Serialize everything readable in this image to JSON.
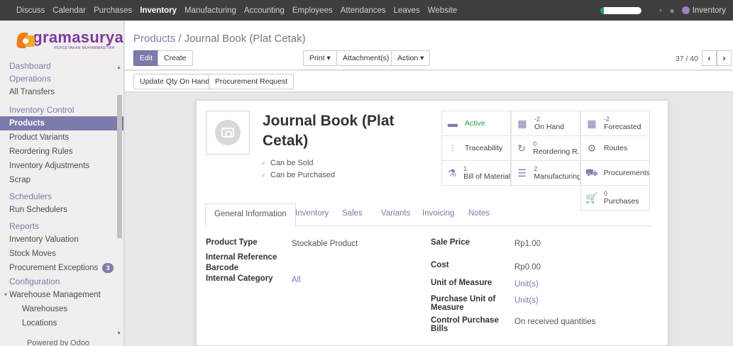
{
  "topbar": {
    "menu": [
      "Discuss",
      "Calendar",
      "Purchases",
      "Inventory",
      "Manufacturing",
      "Accounting",
      "Employees",
      "Attendances",
      "Leaves",
      "Website"
    ],
    "active": "Inventory",
    "user": "Inventory"
  },
  "sidebar": {
    "logo_name": "gramasurya",
    "logo_tag": "PERCETAKAN MUHAMMADIYAH",
    "dashboard": "Dashboard",
    "operations": "Operations",
    "all_transfers": "All Transfers",
    "inventory_control": "Inventory Control",
    "products": "Products",
    "product_variants": "Product Variants",
    "reordering_rules": "Reordering Rules",
    "inventory_adjustments": "Inventory Adjustments",
    "scrap": "Scrap",
    "schedulers": "Schedulers",
    "run_schedulers": "Run Schedulers",
    "reports": "Reports",
    "inventory_valuation": "Inventory Valuation",
    "stock_moves": "Stock Moves",
    "procurement_exceptions": "Procurement Exceptions",
    "procurement_exceptions_count": "3",
    "configuration": "Configuration",
    "warehouse_management": "Warehouse Management",
    "warehouses": "Warehouses",
    "locations": "Locations",
    "powered": "Powered by Odoo"
  },
  "control": {
    "breadcrumb_parent": "Products",
    "breadcrumb_sep": " / ",
    "breadcrumb_current": "Journal Book (Plat Cetak)",
    "edit": "Edit",
    "create": "Create",
    "print": "Print ▾",
    "attachments": "Attachment(s) ▾",
    "action": "Action ▾",
    "pager": "37 / 40"
  },
  "statusbar": {
    "update_qty": "Update Qty On Hand",
    "procurement_request": "Procurement Request"
  },
  "product": {
    "name": "Journal Book (Plat Cetak)",
    "can_be_sold": "Can be Sold",
    "can_be_purchased": "Can be Purchased"
  },
  "smart_buttons": {
    "active": "Active",
    "on_hand_value": "-2",
    "on_hand_label": "On Hand",
    "forecasted_value": "-2",
    "forecasted_label": "Forecasted",
    "traceability": "Traceability",
    "reordering_value": "0",
    "reordering_label": "Reordering R...",
    "routes": "Routes",
    "bom_value": "1",
    "bom_label": "Bill of Materials",
    "manufacturing_value": "2",
    "manufacturing_label": "Manufacturing",
    "procurements": "Procurements",
    "purchases_value": "0",
    "purchases_label": "Purchases"
  },
  "tabs": [
    "General Information",
    "Inventory",
    "Sales",
    "Variants",
    "Invoicing",
    "Notes"
  ],
  "general": {
    "product_type_label": "Product Type",
    "product_type_value": "Stockable Product",
    "internal_reference_label": "Internal Reference",
    "barcode_label": "Barcode",
    "internal_category_label": "Internal Category",
    "internal_category_value": "All",
    "sale_price_label": "Sale Price",
    "sale_price_value": "Rp1.00",
    "cost_label": "Cost",
    "cost_value": "Rp0.00",
    "uom_label": "Unit of Measure",
    "uom_value": "Unit(s)",
    "purchase_uom_label": "Purchase Unit of Measure",
    "purchase_uom_value": "Unit(s)",
    "control_purchase_label": "Control Purchase Bills",
    "control_purchase_value": "On received quantities"
  }
}
